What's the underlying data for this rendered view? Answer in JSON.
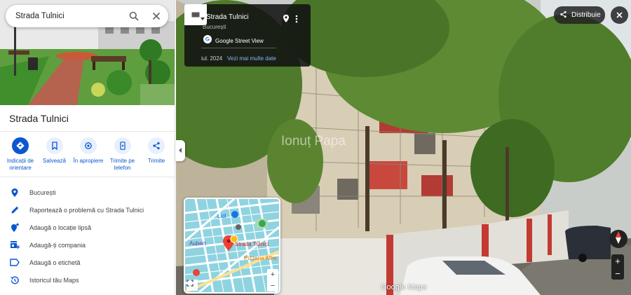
{
  "search": {
    "value": "Strada Tulnici"
  },
  "place": {
    "title": "Strada Tulnici"
  },
  "actions": [
    {
      "label": "Indicații de orientare",
      "icon": "directions-icon"
    },
    {
      "label": "Salvează",
      "icon": "bookmark-icon"
    },
    {
      "label": "În apropiere",
      "icon": "nearby-icon"
    },
    {
      "label": "Trimite pe telefon",
      "icon": "send-to-phone-icon"
    },
    {
      "label": "Trimite",
      "icon": "share-icon"
    }
  ],
  "info_items": [
    {
      "label": "București",
      "icon": "location-pin-icon"
    },
    {
      "label": "Raportează o problemă cu Strada Tulnici",
      "icon": "pencil-icon"
    },
    {
      "label": "Adaugă o locație lipsă",
      "icon": "add-location-icon"
    },
    {
      "label": "Adaugă-ți compania",
      "icon": "add-business-icon"
    },
    {
      "label": "Adaugă o etichetă",
      "icon": "label-icon"
    },
    {
      "label": "Istoricul tău Maps",
      "icon": "history-icon"
    }
  ],
  "street_view": {
    "card_title": "Strada Tulnici",
    "card_subtitle": "București",
    "source": "Google Street View",
    "date": "iul. 2024",
    "more_dates": "Vezi mai multe date",
    "share_label": "Distribuie",
    "watermark": "Ionuț Papa",
    "logo": "Google Maps"
  },
  "mini_map": {
    "labels": {
      "lidl": "Lidl",
      "aubert": "Aubert",
      "street": "Strada Tulnici",
      "pizzeria": "Pizzeria Athe"
    },
    "zoom_in": "+",
    "zoom_out": "−"
  },
  "zoom": {
    "in": "+",
    "out": "−"
  },
  "colors": {
    "accent": "#0b57d0",
    "action_bg": "#e8f0fe",
    "link": "#8ab4f8",
    "pin": "#ea4335"
  }
}
